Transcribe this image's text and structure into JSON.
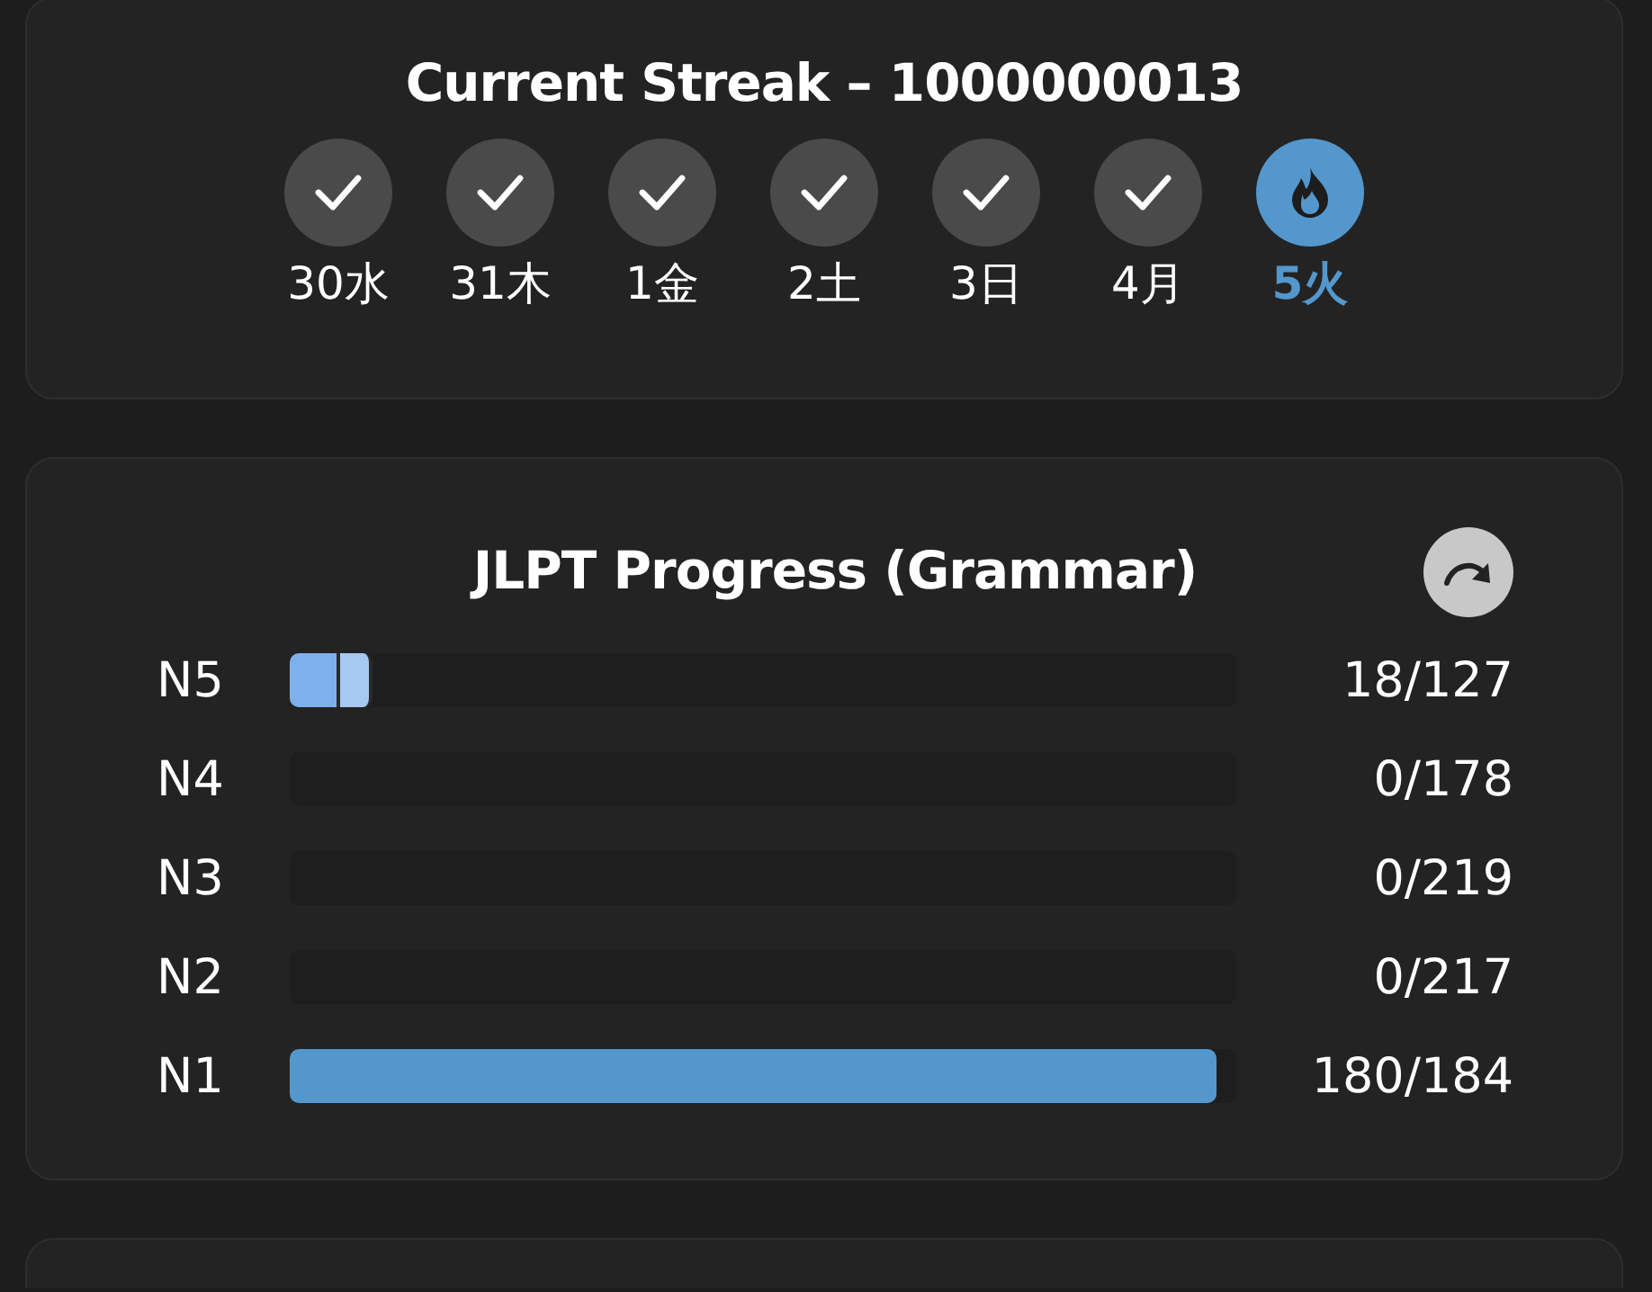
{
  "streak": {
    "title": "Current Streak – 1000000013",
    "days": [
      {
        "label": "30水",
        "kind": "done"
      },
      {
        "label": "31木",
        "kind": "done"
      },
      {
        "label": "1金",
        "kind": "done"
      },
      {
        "label": "2土",
        "kind": "done"
      },
      {
        "label": "3日",
        "kind": "done"
      },
      {
        "label": "4月",
        "kind": "done"
      },
      {
        "label": "5火",
        "kind": "today"
      }
    ]
  },
  "progress": {
    "title": "JLPT Progress (Grammar)",
    "levels": [
      {
        "name": "N5",
        "count": "18/127",
        "segments": [
          {
            "level": 0.054,
            "color": "#7fb0ee"
          },
          {
            "level": 0.088,
            "color": "#a6c9f1"
          }
        ]
      },
      {
        "name": "N4",
        "count": "0/178"
      },
      {
        "name": "N3",
        "count": "0/219"
      },
      {
        "name": "N2",
        "count": "0/217"
      },
      {
        "name": "N1",
        "count": "180/184",
        "segments": [
          {
            "level": 0.98,
            "color": "#5497cc"
          }
        ]
      }
    ]
  }
}
